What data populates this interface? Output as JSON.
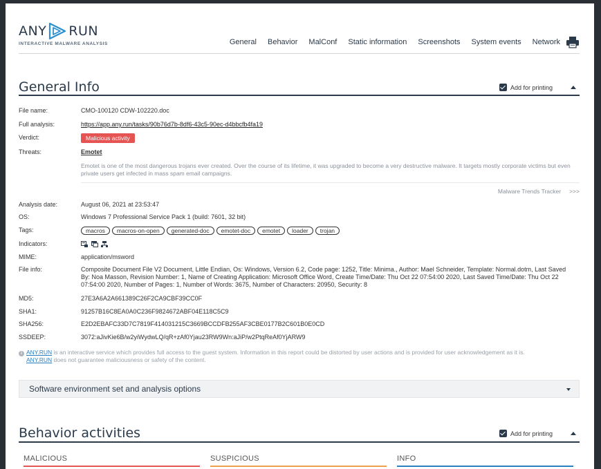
{
  "header": {
    "logo_left": "ANY",
    "logo_right": "RUN",
    "logo_sub": "INTERACTIVE MALWARE ANALYSIS",
    "nav": [
      "General",
      "Behavior",
      "MalConf",
      "Static information",
      "Screenshots",
      "System events",
      "Network"
    ]
  },
  "general": {
    "title": "General Info",
    "print_label": "Add for printing",
    "file_name_label": "File name:",
    "file_name": "CMO-100120 CDW-102220.doc",
    "full_analysis_label": "Full analysis:",
    "full_analysis": "https://app.any.run/tasks/90b76d7b-8df6-43c5-90ec-d4bbcfb4fa19",
    "verdict_label": "Verdict:",
    "verdict": "Malicious activity",
    "threats_label": "Threats:",
    "threat": "Emotet",
    "threat_desc": "Emotet is one of the most dangerous trojans ever created. Over the course of its lifetime, it was upgraded to become a very destructive malware. It targets mostly corporate victims but even private users get infected in mass spam email campaigns.",
    "trends_label": "Malware Trends Tracker",
    "trends_arrow": ">>>",
    "analysis_date_label": "Analysis date:",
    "analysis_date": "August 06, 2021 at 23:53:47",
    "os_label": "OS:",
    "os": "Windows 7 Professional Service Pack 1 (build: 7601, 32 bit)",
    "tags_label": "Tags:",
    "tags": [
      "macros",
      "macros-on-open",
      "generated-doc",
      "emotet-doc",
      "emotet",
      "loader",
      "trojan"
    ],
    "indicators_label": "Indicators:",
    "mime_label": "MIME:",
    "mime": "application/msword",
    "file_info_label": "File info:",
    "file_info": "Composite Document File V2 Document, Little Endian, Os: Windows, Version 6.2, Code page: 1252, Title: Minima., Author: Mael Schneider, Template: Normal.dotm, Last Saved By: Noa Masson, Revision Number: 1, Name of Creating Application: Microsoft Office Word, Create Time/Date: Thu Oct 22 07:54:00 2020, Last Saved Time/Date: Thu Oct 22 07:54:00 2020, Number of Pages: 1, Number of Words: 3675, Number of Characters: 20950, Security: 8",
    "md5_label": "MD5:",
    "md5": "27E3A6A2A661389C26F2CA9CBF39CC0F",
    "sha1_label": "SHA1:",
    "sha1": "91257B16C8EA0A0C236F9824672ABF04E118C5C9",
    "sha256_label": "SHA256:",
    "sha256": "E2D2EBAFC33D7C7819F414031215C3669BCCDFB255AF3CBE0177B2C601B0E0CD",
    "ssdeep_label": "SSDEEP:",
    "ssdeep": "3072:aJivKie6B/w2yiWydwLQ/qR+zAf0Yjau23RW9Wn:aJiP/w2PtqReAf0YjARW9",
    "note_link1": "ANY.RUN",
    "note_text1": " is an interactive service which provides full access to the guest system. Information in this report could be distorted by user actions and is provided for user acknowledgement as it is.",
    "note_link2": "ANY.RUN",
    "note_text2": " does not guarantee maliciousness or safety of the content."
  },
  "environment": {
    "title": "Software environment set and analysis options"
  },
  "behavior": {
    "title": "Behavior activities",
    "print_label": "Add for printing",
    "columns": [
      "MALICIOUS",
      "SUSPICIOUS",
      "INFO"
    ]
  },
  "colors": {
    "malicious": "#e55353",
    "suspicious": "#f0a04b",
    "info": "#2a7fc0",
    "dark": "#2b3a4a"
  }
}
